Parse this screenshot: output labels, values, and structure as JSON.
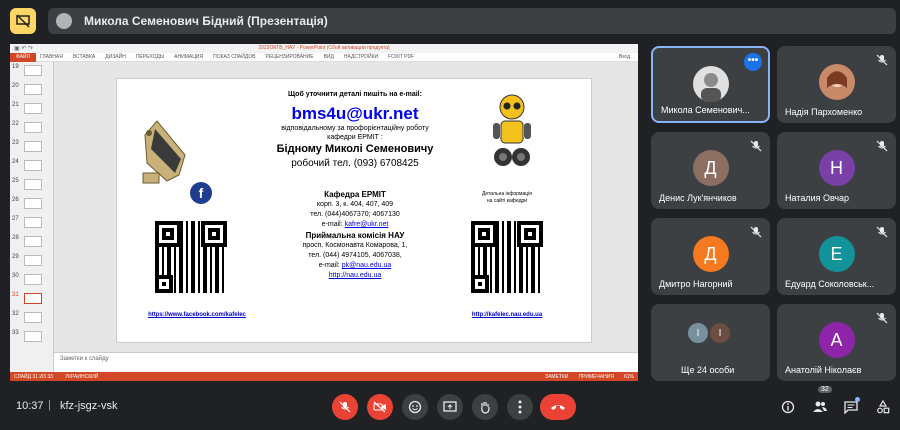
{
  "top": {
    "presenter_title": "Микола Семенович Бідний (Презентація)"
  },
  "ppt": {
    "window_title": "2023ОКТВ_НАУ - PowerPoint (Сбой активации продукта)",
    "tabs": [
      "ФАЙЛ",
      "ГЛАВНАЯ",
      "ВСТАВКА",
      "ДИЗАЙН",
      "ПЕРЕХОДЫ",
      "АНИМАЦИЯ",
      "ПОКАЗ СЛАЙДОВ",
      "РЕЦЕНЗИРОВАНИЕ",
      "ВИД",
      "НАДСТРОЙКИ",
      "FOXIT PDF"
    ],
    "login": "Вход",
    "slide_numbers": [
      "19",
      "20",
      "21",
      "22",
      "23",
      "24",
      "25",
      "26",
      "27",
      "28",
      "29",
      "30",
      "31",
      "32",
      "33"
    ],
    "selected_slide": "31",
    "notes_placeholder": "Заметки к слайду",
    "status_left": "СЛАЙД 31 ИЗ 33",
    "status_lang": "УКРАИНСКИЙ",
    "status_notes": "ЗАМЕТКИ",
    "status_comments": "ПРИМЕЧАНИЯ",
    "zoom": "61%"
  },
  "slide": {
    "line1": "Щоб уточнити деталі пишіть на e-mail:",
    "email": "bms4u@ukr.net",
    "line3": "відповідальному за профорієнтаційну роботу",
    "line4": "кафедри ЕРМІТ :",
    "name": "Бідному Миколі Семеновичу",
    "phone": "робочий тел. (093) 6708425",
    "dept_title": "Кафедра ЕРМІТ",
    "dept_addr": "корп. 3, к. 404, 407, 409",
    "dept_tel": "тел. (044)4067370; 4067130",
    "dept_email_label": "e-mail:",
    "dept_email": "kafre@ukr.net",
    "commission_title": "Приймальна комісія НАУ",
    "commission_addr": "просп. Космонавта Комарова, 1,",
    "commission_tel": "тел. (044) 4974105, 4067038,",
    "commission_email_label": "e-mail:",
    "commission_email": "pk@nau.edu.ua",
    "commission_site": "http://nau.edu.ua",
    "details_line1": "Детальна інформація",
    "details_line2": "на сайті кафедри",
    "facebook_link": "https://www.facebook.com/kafelec",
    "site_link": "http://kafelec.nau.edu.ua",
    "fb_glyph": "f"
  },
  "participants": [
    {
      "name": "Микола Семенович...",
      "type": "photo",
      "color": "#d9d9d9"
    },
    {
      "name": "Надія Пархоменко",
      "type": "photo",
      "color": "#c98a6a"
    },
    {
      "name": "Денис Лук'янчиков",
      "initial": "Д",
      "color": "#8d6e63"
    },
    {
      "name": "Наталия Овчар",
      "initial": "Н",
      "color": "#7b3fa8"
    },
    {
      "name": "Дмитро Нагорний",
      "initial": "Д",
      "color": "#f4791f"
    },
    {
      "name": "Едуард Соколовськ...",
      "initial": "Е",
      "color": "#12939a"
    },
    {
      "name": "Ще 24 особи",
      "type": "group"
    },
    {
      "name": "Анатолій Ніколаєв",
      "initial": "А",
      "color": "#8e24aa"
    }
  ],
  "group_initials": [
    "І",
    "І"
  ],
  "bottom": {
    "time": "10:37",
    "meeting_code": "kfz-jsgz-vsk",
    "people_count": "32"
  },
  "colors": {
    "accent": "#8ab4f8",
    "danger": "#ea4335",
    "present_yellow": "#fdd663",
    "ppt_orange": "#d24726"
  }
}
